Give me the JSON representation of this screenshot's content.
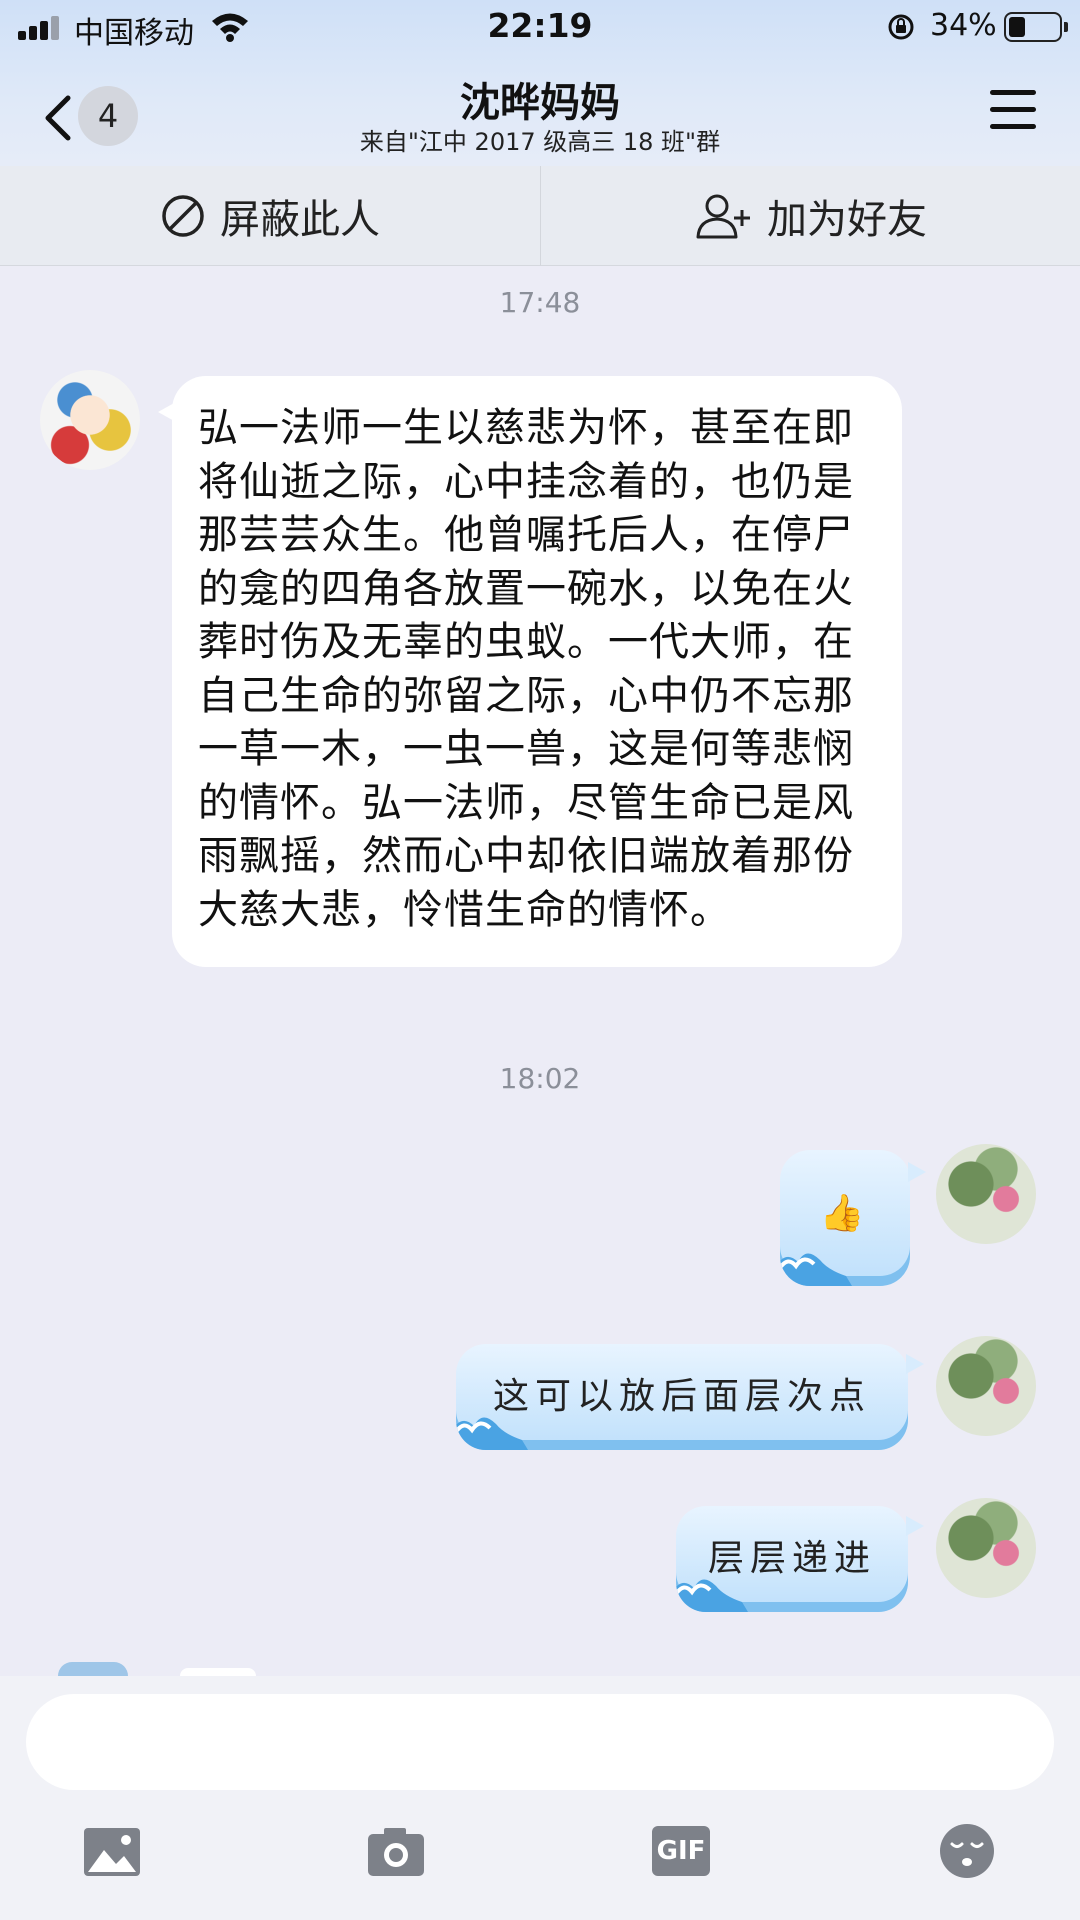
{
  "status_bar": {
    "carrier": "中国移动",
    "time": "22:19",
    "battery_percent": "34%",
    "battery_level": 0.34
  },
  "nav": {
    "unread_count": "4",
    "title": "沈晔妈妈",
    "subtitle": "来自\"江中 2017 级高三 18 班\"群"
  },
  "actions": {
    "block_label": "屏蔽此人",
    "add_friend_label": "加为好友"
  },
  "messages": {
    "time_1": "17:48",
    "long_text": "弘一法师一生以慈悲为怀，甚至在即将仙逝之际，心中挂念着的，也仍是那芸芸众生。他曾嘱托后人，在停尸的龛的四角各放置一碗水，以免在火葬时伤及无辜的虫蚁。一代大师，在自己生命的弥留之际，心中仍不忘那一草一木，一虫一兽，这是何等悲悯的情怀。弘一法师，尽管生命已是风雨飘摇，然而心中却依旧端放着那份大慈大悲，怜惜生命的情怀。",
    "time_2": "18:02",
    "thumb_emoji": "👍",
    "reply_1": "这可以放后面层次点",
    "reply_2": "层层递进"
  },
  "input": {
    "placeholder": ""
  },
  "toolbar": {
    "icons": [
      "image-icon",
      "camera-icon",
      "gif-icon",
      "emoji-icon"
    ],
    "gif_label": "GIF"
  },
  "colors": {
    "header_bg": "#d8e6f8",
    "chat_bg": "#ececf6",
    "bubble_left": "#ffffff",
    "bubble_right": "#cfe7fc",
    "bubble_right_wave": "#7fc0ef"
  }
}
